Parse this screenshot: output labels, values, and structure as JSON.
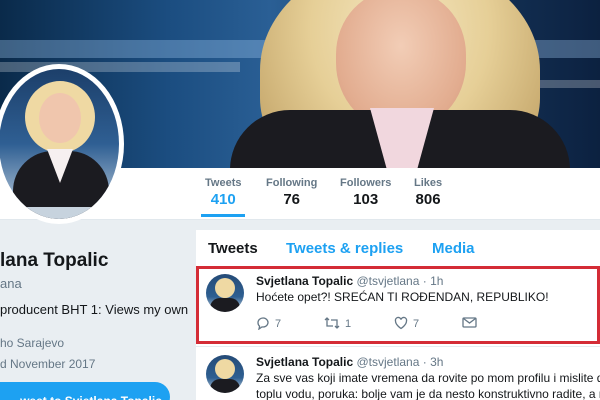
{
  "profile": {
    "name": "lana Topalic",
    "handle": "ana",
    "bio": "producent BHT 1: Views my own",
    "location": "ho Sarajevo",
    "joined": "d November 2017",
    "tweet_to_button": "weet to Svjetlana Topalic"
  },
  "stats": [
    {
      "label": "Tweets",
      "value": "410"
    },
    {
      "label": "Following",
      "value": "76"
    },
    {
      "label": "Followers",
      "value": "103"
    },
    {
      "label": "Likes",
      "value": "806"
    }
  ],
  "tabs": [
    {
      "label": "Tweets"
    },
    {
      "label": "Tweets & replies"
    },
    {
      "label": "Media"
    }
  ],
  "tweets": [
    {
      "name": "Svjetlana Topalic",
      "handle": "@tsvjetlana",
      "time": "· 1h",
      "lines": [
        "Hoćete opet?! SREĆAN TI ROĐENDAN, REPUBLIKO!"
      ],
      "replies": "7",
      "retweets": "1",
      "likes": "7"
    },
    {
      "name": "Svjetlana Topalic",
      "handle": "@tsvjetlana",
      "time": "· 3h",
      "lines": [
        "Za sve vas koji imate vremena da rovite po mom profilu i mislite da",
        "toplu vodu, poruka: bolje vam je da nesto konstruktivno radite, a n"
      ]
    }
  ],
  "colors": {
    "accent": "#1da1f2",
    "highlight_border": "#d42c36"
  }
}
